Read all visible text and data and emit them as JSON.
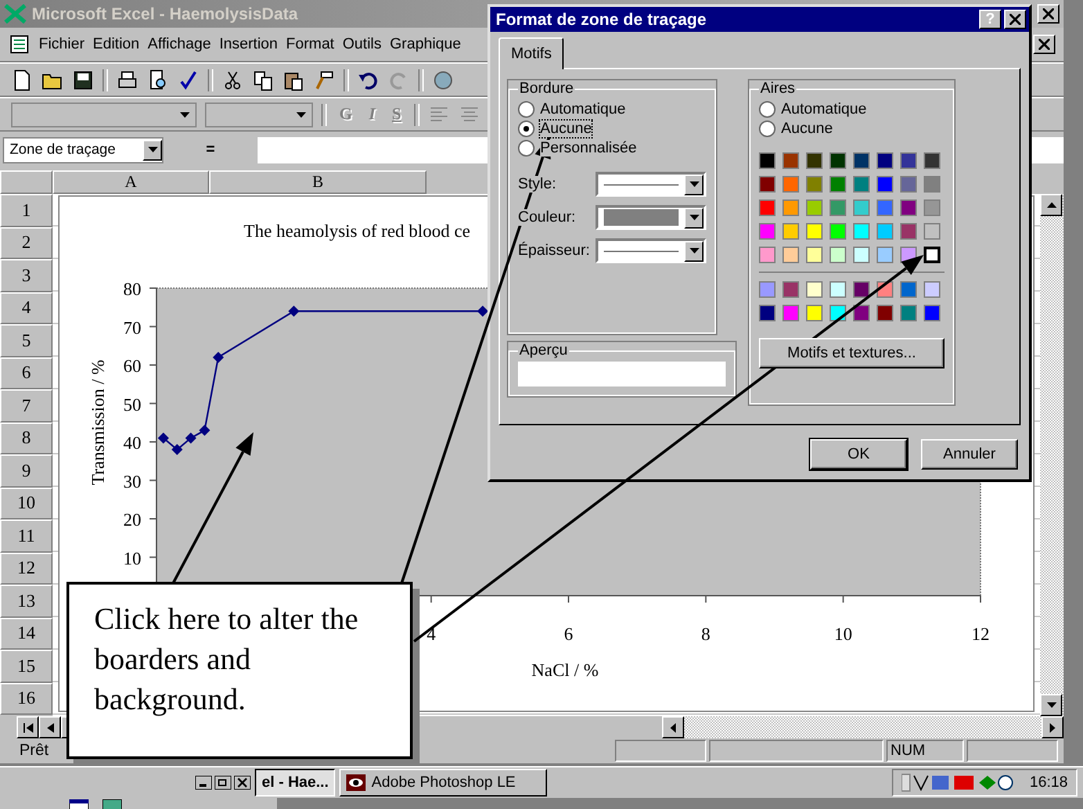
{
  "window": {
    "title": "Microsoft Excel - HaemolysisData"
  },
  "menu": [
    "Fichier",
    "Edition",
    "Affichage",
    "Insertion",
    "Format",
    "Outils",
    "Graphique"
  ],
  "format_toolbar": {
    "buttons": [
      {
        "label": "G",
        "disabled": true
      },
      {
        "label": "I",
        "disabled": true
      },
      {
        "label": "S",
        "disabled": true
      }
    ]
  },
  "formula_bar": {
    "name_box": "Zone de traçage",
    "equals": "="
  },
  "columns": [
    "A",
    "B"
  ],
  "rows": [
    "1",
    "2",
    "3",
    "4",
    "5",
    "6",
    "7",
    "8",
    "9",
    "10",
    "11",
    "12",
    "13",
    "14",
    "15",
    "16"
  ],
  "chart": {
    "chart_data": {
      "type": "line",
      "title": "The heamolysis of red blood ce",
      "xlabel": "NaCl / %",
      "ylabel": "Transmission / %",
      "x": [
        0.1,
        0.3,
        0.5,
        0.7,
        0.9,
        2,
        4.75
      ],
      "series": [
        {
          "color": "#000080",
          "marker": "diamond",
          "values": [
            41,
            38,
            41,
            43,
            62,
            74,
            74
          ]
        }
      ],
      "xlim": [
        0,
        12
      ],
      "ylim": [
        0,
        80
      ],
      "xticks": [
        4,
        6,
        8,
        10,
        12
      ],
      "yticks": [
        10,
        20,
        30,
        40,
        50,
        60,
        70,
        80
      ]
    }
  },
  "dialog": {
    "title": "Format de zone de traçage",
    "help": "?",
    "tabs": [
      {
        "label": "Motifs",
        "selected": true
      }
    ],
    "border": {
      "legend": "Bordure",
      "options": [
        {
          "label": "Automatique",
          "selected": false
        },
        {
          "label": "Aucune",
          "selected": true
        },
        {
          "label": "Personnalisée",
          "selected": false
        }
      ],
      "fields": [
        {
          "label": "Style:",
          "kind": "line"
        },
        {
          "label": "Couleur:",
          "kind": "color",
          "color": "#808080"
        },
        {
          "label": "Épaisseur:",
          "kind": "line"
        }
      ]
    },
    "preview": {
      "legend": "Aperçu"
    },
    "area": {
      "legend": "Aires",
      "options": [
        {
          "label": "Automatique",
          "selected": false
        },
        {
          "label": "Aucune",
          "selected": false
        }
      ],
      "palette": [
        [
          [
            {
              "color": "#000000",
              "selected": false
            },
            {
              "color": "#993300",
              "selected": false
            },
            {
              "color": "#333300",
              "selected": false
            },
            {
              "color": "#003300",
              "selected": false
            },
            {
              "color": "#003366",
              "selected": false
            },
            {
              "color": "#000080",
              "selected": false
            },
            {
              "color": "#333399",
              "selected": false
            },
            {
              "color": "#333333",
              "selected": false
            }
          ],
          [
            {
              "color": "#800000",
              "selected": false
            },
            {
              "color": "#ff6600",
              "selected": false
            },
            {
              "color": "#808000",
              "selected": false
            },
            {
              "color": "#008000",
              "selected": false
            },
            {
              "color": "#008080",
              "selected": false
            },
            {
              "color": "#0000ff",
              "selected": false
            },
            {
              "color": "#666699",
              "selected": false
            },
            {
              "color": "#808080",
              "selected": false
            }
          ],
          [
            {
              "color": "#ff0000",
              "selected": false
            },
            {
              "color": "#ff9900",
              "selected": false
            },
            {
              "color": "#99cc00",
              "selected": false
            },
            {
              "color": "#339966",
              "selected": false
            },
            {
              "color": "#33cccc",
              "selected": false
            },
            {
              "color": "#3366ff",
              "selected": false
            },
            {
              "color": "#800080",
              "selected": false
            },
            {
              "color": "#969696",
              "selected": false
            }
          ],
          [
            {
              "color": "#ff00ff",
              "selected": false
            },
            {
              "color": "#ffcc00",
              "selected": false
            },
            {
              "color": "#ffff00",
              "selected": false
            },
            {
              "color": "#00ff00",
              "selected": false
            },
            {
              "color": "#00ffff",
              "selected": false
            },
            {
              "color": "#00ccff",
              "selected": false
            },
            {
              "color": "#993366",
              "selected": false
            },
            {
              "color": "#c0c0c0",
              "selected": false
            }
          ],
          [
            {
              "color": "#ff99cc",
              "selected": false
            },
            {
              "color": "#ffcc99",
              "selected": false
            },
            {
              "color": "#ffff99",
              "selected": false
            },
            {
              "color": "#ccffcc",
              "selected": false
            },
            {
              "color": "#ccffff",
              "selected": false
            },
            {
              "color": "#99ccff",
              "selected": false
            },
            {
              "color": "#cc99ff",
              "selected": false
            },
            {
              "color": "#ffffff",
              "selected": true
            }
          ]
        ],
        [
          [
            {
              "color": "#9999ff",
              "selected": false
            },
            {
              "color": "#993366",
              "selected": false
            },
            {
              "color": "#ffffcc",
              "selected": false
            },
            {
              "color": "#ccffff",
              "selected": false
            },
            {
              "color": "#660066",
              "selected": false
            },
            {
              "color": "#ff8080",
              "selected": false
            },
            {
              "color": "#0066cc",
              "selected": false
            },
            {
              "color": "#ccccff",
              "selected": false
            }
          ],
          [
            {
              "color": "#000080",
              "selected": false
            },
            {
              "color": "#ff00ff",
              "selected": false
            },
            {
              "color": "#ffff00",
              "selected": false
            },
            {
              "color": "#00ffff",
              "selected": false
            },
            {
              "color": "#800080",
              "selected": false
            },
            {
              "color": "#800000",
              "selected": false
            },
            {
              "color": "#008080",
              "selected": false
            },
            {
              "color": "#0000ff",
              "selected": false
            }
          ]
        ]
      ],
      "button": "Motifs et textures..."
    },
    "buttons": [
      "OK",
      "Annuler"
    ]
  },
  "callout": {
    "text": "Click here to alter the boarders and background."
  },
  "status_bar": {
    "left": "Prêt",
    "indicators": [
      "NUM"
    ]
  },
  "taskbar": {
    "tasks": [
      {
        "label": "el - Hae...",
        "selected": true
      },
      {
        "label": "Adobe Photoshop LE",
        "selected": false
      }
    ],
    "clock": "16:18"
  }
}
